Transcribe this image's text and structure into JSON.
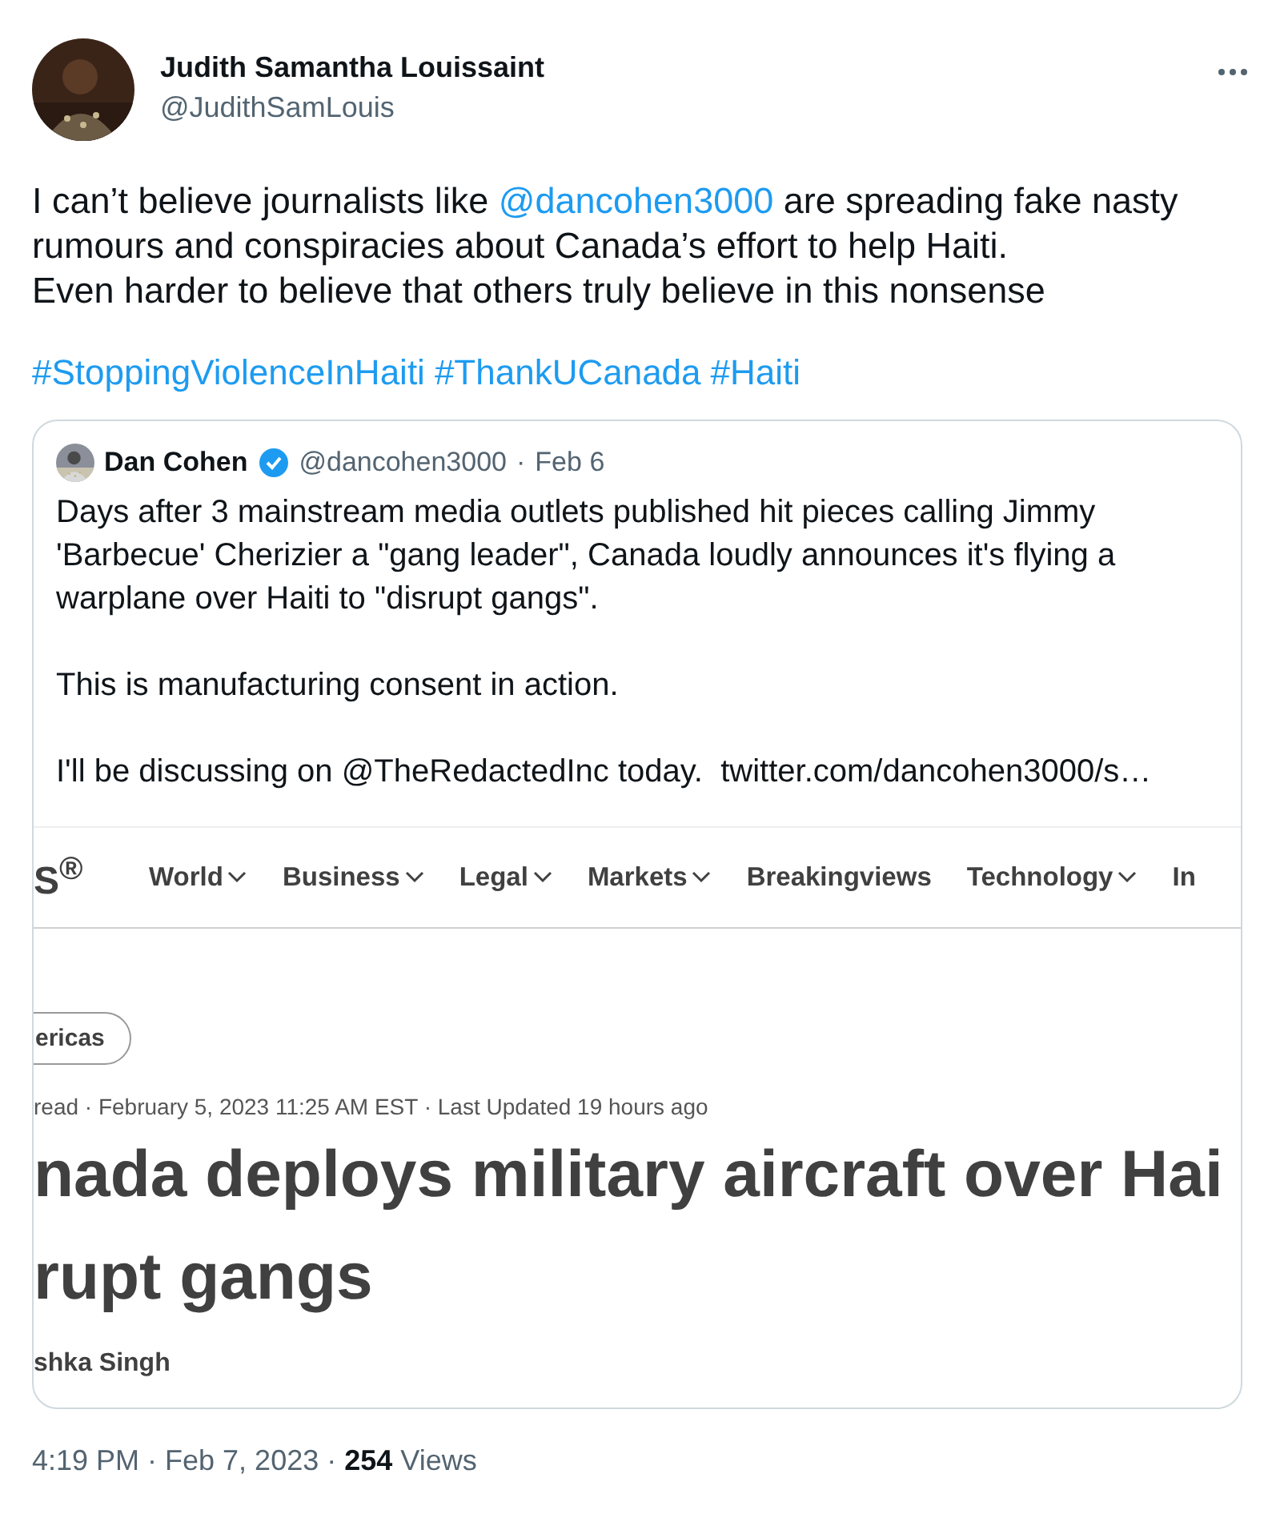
{
  "author": {
    "name": "Judith Samantha Louissaint",
    "handle": "@JudithSamLouis"
  },
  "text": [
    {
      "kind": "text",
      "text": "I can’t believe journalists like "
    },
    {
      "kind": "mention",
      "text": "@dancohen3000"
    },
    {
      "kind": "text",
      "text": " are spreading fake nasty rumours and conspiracies about Canada’s effort to help Haiti.\nEven harder to believe that others truly believe in this nonsense"
    }
  ],
  "hashtags": [
    "#StoppingViolenceInHaiti",
    "#ThankUCanada",
    "#Haiti"
  ],
  "quote": {
    "name": "Dan Cohen",
    "verified": true,
    "handle": "@dancohen3000",
    "separator": "·",
    "date": "Feb 6",
    "text": "Days after 3 mainstream media outlets published hit pieces calling Jimmy 'Barbecue' Cherizier a \"gang leader\", Canada loudly announces it's flying a warplane over Haiti to \"disrupt gangs\".\n\nThis is manufacturing consent in action.\n\nI'll be discussing on @TheRedactedInc today.  twitter.com/dancohen3000/s…",
    "media": {
      "logo": "S",
      "logo_mark": "®",
      "nav": [
        {
          "label": "World",
          "dropdown": true
        },
        {
          "label": "Business",
          "dropdown": true
        },
        {
          "label": "Legal",
          "dropdown": true
        },
        {
          "label": "Markets",
          "dropdown": true
        },
        {
          "label": "Breakingviews",
          "dropdown": false
        },
        {
          "label": "Technology",
          "dropdown": true
        },
        {
          "label": "In",
          "dropdown": false
        }
      ],
      "tag": "ericas",
      "meta": "read · February 5, 2023 11:25 AM EST · Last Updated 19 hours ago",
      "headline": [
        "nada deploys military aircraft over Hai",
        "rupt gangs"
      ],
      "byline": "shka Singh"
    }
  },
  "footer": "4:19 PM · Feb 7, 2023 · **254** Views"
}
